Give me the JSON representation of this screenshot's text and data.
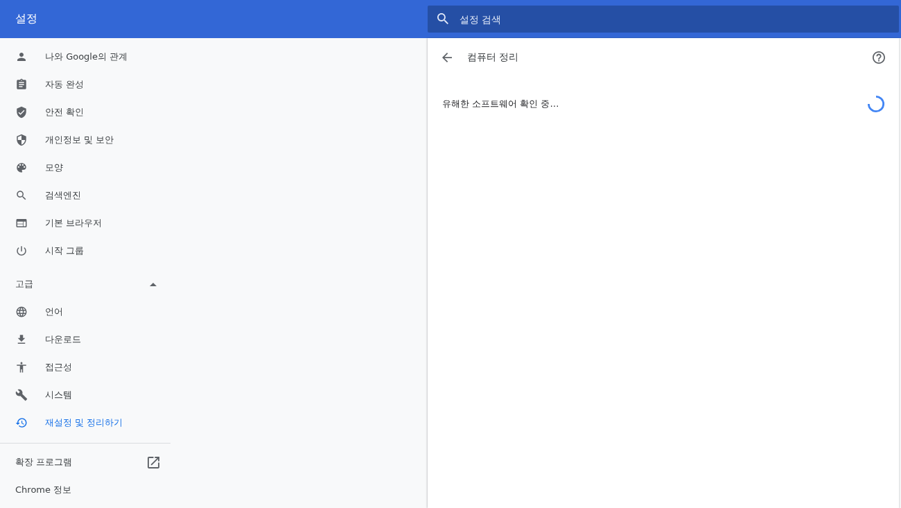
{
  "header": {
    "title": "설정",
    "search": {
      "placeholder": "설정 검색"
    }
  },
  "sidebar": {
    "items": [
      {
        "label": "나와 Google의 관계",
        "selected": false
      },
      {
        "label": "자동 완성",
        "selected": false
      },
      {
        "label": "안전 확인",
        "selected": false
      },
      {
        "label": "개인정보 및 보안",
        "selected": false
      },
      {
        "label": "모양",
        "selected": false
      },
      {
        "label": "검색엔진",
        "selected": false
      },
      {
        "label": "기본 브라우저",
        "selected": false
      },
      {
        "label": "시작 그룹",
        "selected": false
      }
    ],
    "advanced": {
      "label": "고급",
      "expanded": true,
      "items": [
        {
          "label": "언어",
          "selected": false
        },
        {
          "label": "다운로드",
          "selected": false
        },
        {
          "label": "접근성",
          "selected": false
        },
        {
          "label": "시스템",
          "selected": false
        },
        {
          "label": "재설정 및 정리하기",
          "selected": true
        }
      ]
    },
    "links": [
      {
        "label": "확장 프로그램",
        "external": true
      },
      {
        "label": "Chrome 정보",
        "external": false
      }
    ]
  },
  "page": {
    "title": "컴퓨터 정리",
    "status": "유해한 소프트웨어 확인 중…"
  }
}
